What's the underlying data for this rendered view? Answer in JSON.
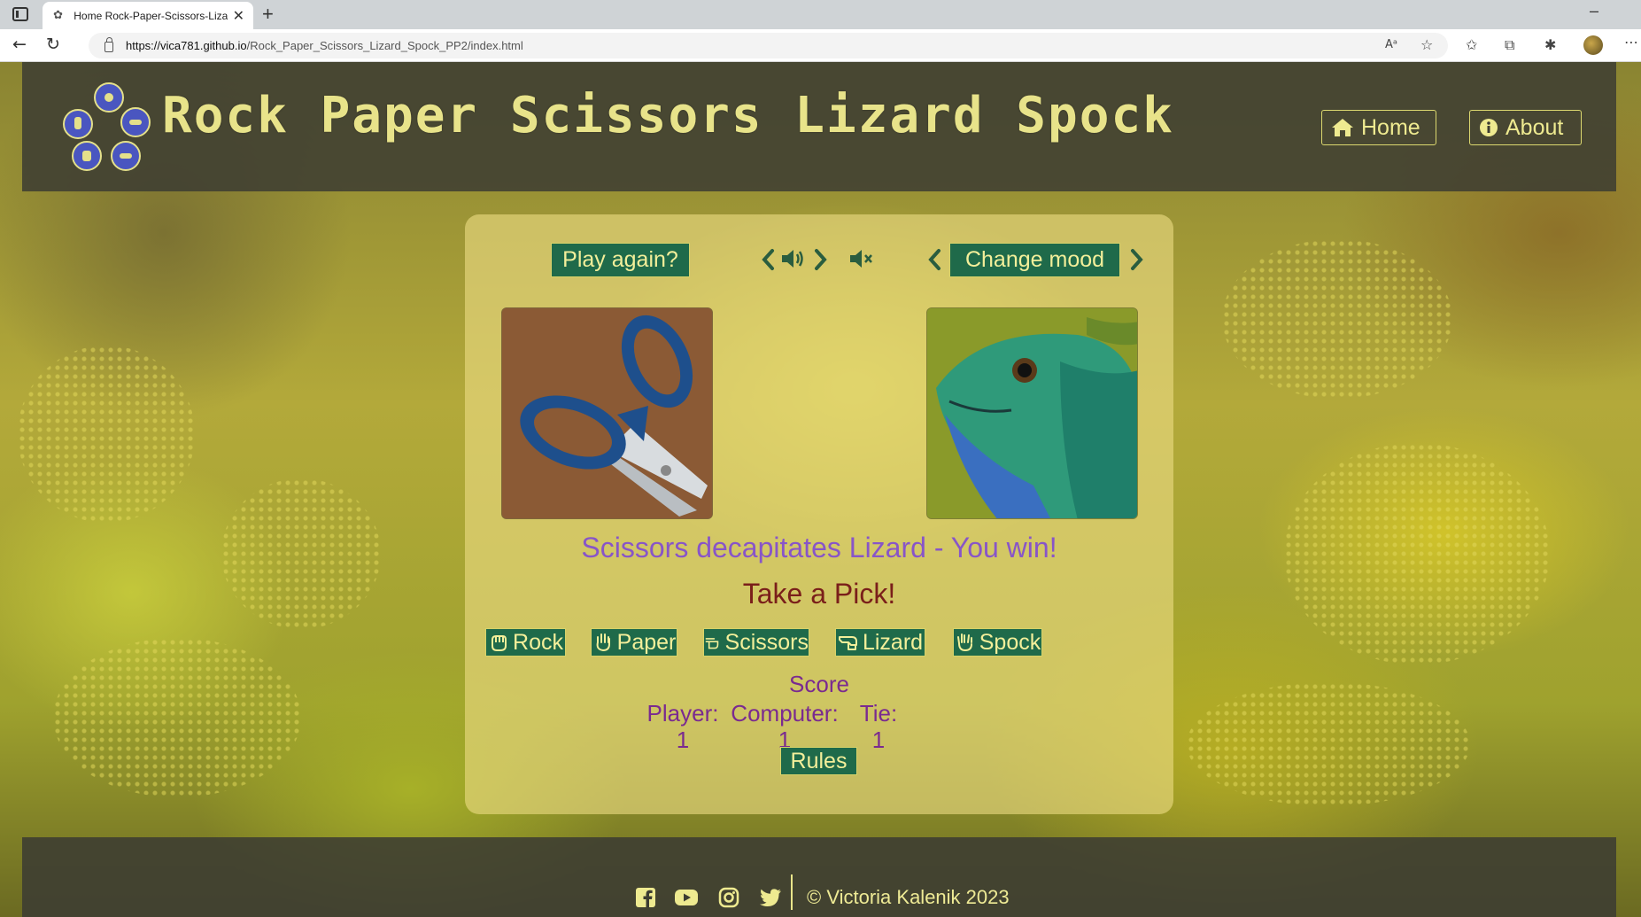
{
  "browser": {
    "tab_title": "Home Rock-Paper-Scissors-Lizard",
    "url_host": "https://vica781.github.io",
    "url_path": "/Rock_Paper_Scissors_Lizard_Spock_PP2/index.html"
  },
  "header": {
    "title": "Rock Paper Scissors Lizard Spock",
    "nav": {
      "home": "Home",
      "about": "About"
    }
  },
  "game": {
    "play_again": "Play again?",
    "change_mood": "Change mood",
    "player_choice_icon": "scissors",
    "computer_choice_icon": "lizard",
    "result_message": "Scissors decapitates Lizard - You win!",
    "prompt": "Take a Pick!",
    "choices": [
      "Rock",
      "Paper",
      "Scissors",
      "Lizard",
      "Spock"
    ],
    "score": {
      "title": "Score",
      "player_label": "Player:",
      "player_value": "1",
      "computer_label": "Computer:",
      "computer_value": "1",
      "tie_label": "Tie:",
      "tie_value": "1"
    },
    "rules": "Rules"
  },
  "footer": {
    "social": [
      "facebook-icon",
      "youtube-icon",
      "instagram-icon",
      "twitter-icon"
    ],
    "copyright": "© Victoria Kalenik 2023"
  },
  "colors": {
    "button_bg": "#1f6a4a",
    "button_text": "#f3ef9a",
    "result_text": "#8855c8",
    "prompt_text": "#7a1f1a",
    "score_text": "#7a2a90",
    "header_bg": "#3c3c32"
  }
}
